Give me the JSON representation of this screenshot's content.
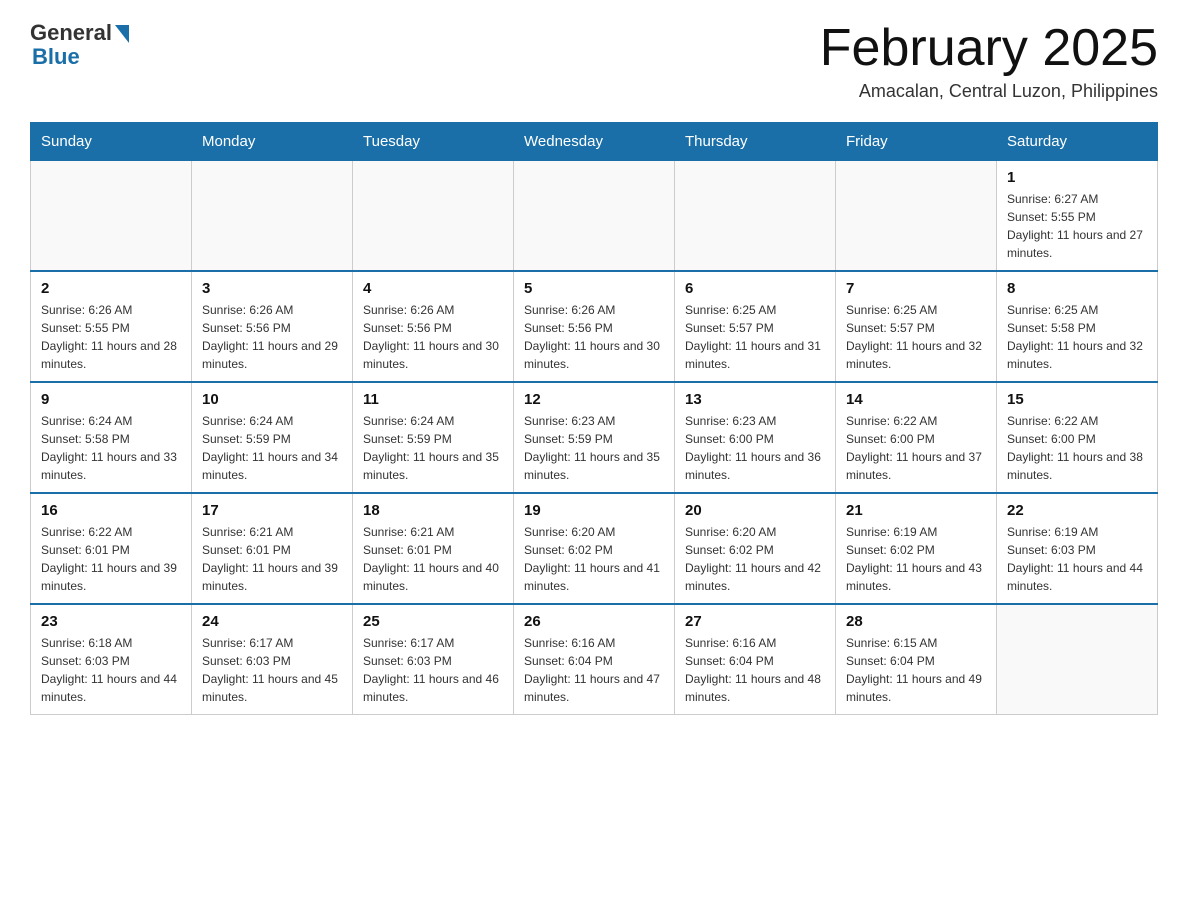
{
  "header": {
    "logo_general": "General",
    "logo_blue": "Blue",
    "month_title": "February 2025",
    "location": "Amacalan, Central Luzon, Philippines"
  },
  "days_of_week": [
    "Sunday",
    "Monday",
    "Tuesday",
    "Wednesday",
    "Thursday",
    "Friday",
    "Saturday"
  ],
  "weeks": [
    [
      {
        "day": "",
        "info": ""
      },
      {
        "day": "",
        "info": ""
      },
      {
        "day": "",
        "info": ""
      },
      {
        "day": "",
        "info": ""
      },
      {
        "day": "",
        "info": ""
      },
      {
        "day": "",
        "info": ""
      },
      {
        "day": "1",
        "info": "Sunrise: 6:27 AM\nSunset: 5:55 PM\nDaylight: 11 hours and 27 minutes."
      }
    ],
    [
      {
        "day": "2",
        "info": "Sunrise: 6:26 AM\nSunset: 5:55 PM\nDaylight: 11 hours and 28 minutes."
      },
      {
        "day": "3",
        "info": "Sunrise: 6:26 AM\nSunset: 5:56 PM\nDaylight: 11 hours and 29 minutes."
      },
      {
        "day": "4",
        "info": "Sunrise: 6:26 AM\nSunset: 5:56 PM\nDaylight: 11 hours and 30 minutes."
      },
      {
        "day": "5",
        "info": "Sunrise: 6:26 AM\nSunset: 5:56 PM\nDaylight: 11 hours and 30 minutes."
      },
      {
        "day": "6",
        "info": "Sunrise: 6:25 AM\nSunset: 5:57 PM\nDaylight: 11 hours and 31 minutes."
      },
      {
        "day": "7",
        "info": "Sunrise: 6:25 AM\nSunset: 5:57 PM\nDaylight: 11 hours and 32 minutes."
      },
      {
        "day": "8",
        "info": "Sunrise: 6:25 AM\nSunset: 5:58 PM\nDaylight: 11 hours and 32 minutes."
      }
    ],
    [
      {
        "day": "9",
        "info": "Sunrise: 6:24 AM\nSunset: 5:58 PM\nDaylight: 11 hours and 33 minutes."
      },
      {
        "day": "10",
        "info": "Sunrise: 6:24 AM\nSunset: 5:59 PM\nDaylight: 11 hours and 34 minutes."
      },
      {
        "day": "11",
        "info": "Sunrise: 6:24 AM\nSunset: 5:59 PM\nDaylight: 11 hours and 35 minutes."
      },
      {
        "day": "12",
        "info": "Sunrise: 6:23 AM\nSunset: 5:59 PM\nDaylight: 11 hours and 35 minutes."
      },
      {
        "day": "13",
        "info": "Sunrise: 6:23 AM\nSunset: 6:00 PM\nDaylight: 11 hours and 36 minutes."
      },
      {
        "day": "14",
        "info": "Sunrise: 6:22 AM\nSunset: 6:00 PM\nDaylight: 11 hours and 37 minutes."
      },
      {
        "day": "15",
        "info": "Sunrise: 6:22 AM\nSunset: 6:00 PM\nDaylight: 11 hours and 38 minutes."
      }
    ],
    [
      {
        "day": "16",
        "info": "Sunrise: 6:22 AM\nSunset: 6:01 PM\nDaylight: 11 hours and 39 minutes."
      },
      {
        "day": "17",
        "info": "Sunrise: 6:21 AM\nSunset: 6:01 PM\nDaylight: 11 hours and 39 minutes."
      },
      {
        "day": "18",
        "info": "Sunrise: 6:21 AM\nSunset: 6:01 PM\nDaylight: 11 hours and 40 minutes."
      },
      {
        "day": "19",
        "info": "Sunrise: 6:20 AM\nSunset: 6:02 PM\nDaylight: 11 hours and 41 minutes."
      },
      {
        "day": "20",
        "info": "Sunrise: 6:20 AM\nSunset: 6:02 PM\nDaylight: 11 hours and 42 minutes."
      },
      {
        "day": "21",
        "info": "Sunrise: 6:19 AM\nSunset: 6:02 PM\nDaylight: 11 hours and 43 minutes."
      },
      {
        "day": "22",
        "info": "Sunrise: 6:19 AM\nSunset: 6:03 PM\nDaylight: 11 hours and 44 minutes."
      }
    ],
    [
      {
        "day": "23",
        "info": "Sunrise: 6:18 AM\nSunset: 6:03 PM\nDaylight: 11 hours and 44 minutes."
      },
      {
        "day": "24",
        "info": "Sunrise: 6:17 AM\nSunset: 6:03 PM\nDaylight: 11 hours and 45 minutes."
      },
      {
        "day": "25",
        "info": "Sunrise: 6:17 AM\nSunset: 6:03 PM\nDaylight: 11 hours and 46 minutes."
      },
      {
        "day": "26",
        "info": "Sunrise: 6:16 AM\nSunset: 6:04 PM\nDaylight: 11 hours and 47 minutes."
      },
      {
        "day": "27",
        "info": "Sunrise: 6:16 AM\nSunset: 6:04 PM\nDaylight: 11 hours and 48 minutes."
      },
      {
        "day": "28",
        "info": "Sunrise: 6:15 AM\nSunset: 6:04 PM\nDaylight: 11 hours and 49 minutes."
      },
      {
        "day": "",
        "info": ""
      }
    ]
  ]
}
